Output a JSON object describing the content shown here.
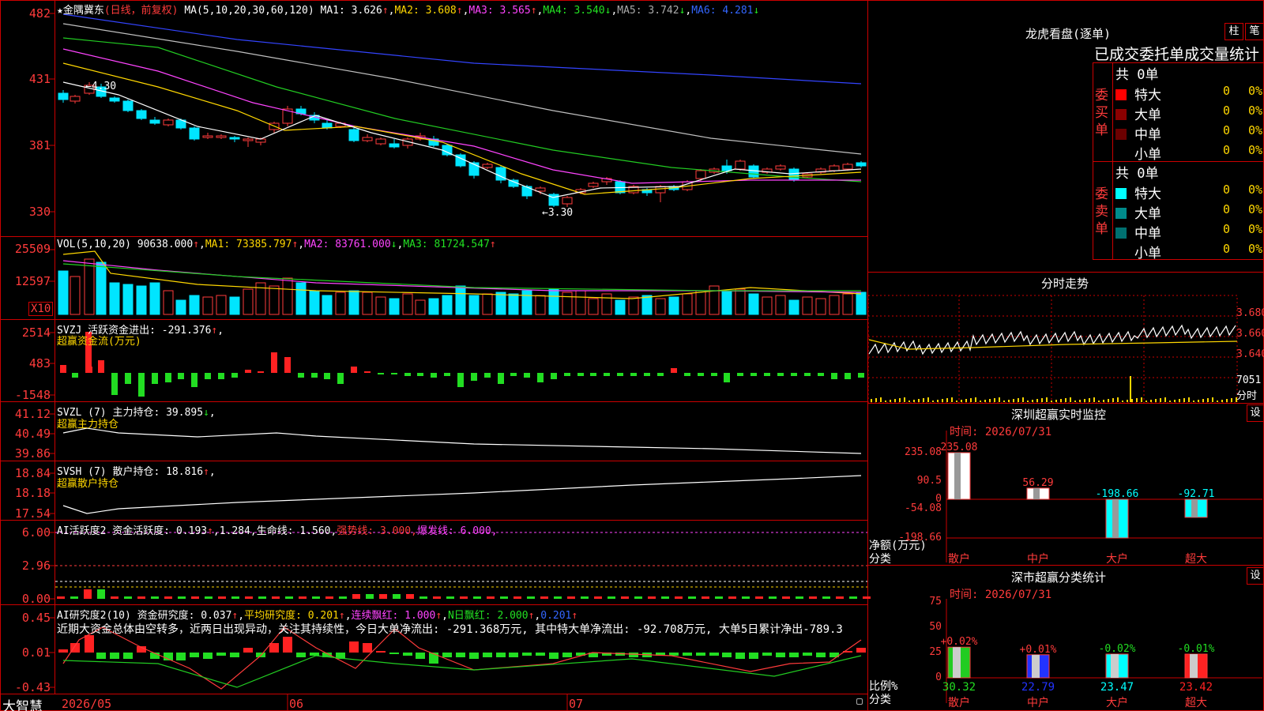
{
  "stock": {
    "title": "金隅冀东",
    "mode": "(日线，前复权)"
  },
  "main": {
    "ma_head": "MA(5,10,20,30,60,120)",
    "ma1": "MA1: 3.626",
    "ma2": "MA2: 3.608",
    "ma3": "MA3: 3.565",
    "ma4": "MA4: 3.540",
    "ma5": "MA5: 3.742",
    "ma6": "MA6: 4.281",
    "up": "↑",
    "down": "↓",
    "hi_label": "←4.30",
    "lo_label": "←3.30",
    "y_ticks": [
      "482",
      "431",
      "381",
      "330"
    ]
  },
  "vol": {
    "head": "VOL(5,10,20)",
    "value": "90638.000",
    "ma1": "MA1: 73385.797",
    "ma2": "MA2: 83761.000",
    "ma3": "MA3: 81724.547",
    "y_ticks": [
      "25509",
      "12597"
    ],
    "unit": "X10"
  },
  "svzj": {
    "head": "SVZJ  活跃资金进出: -291.376",
    "sub": "超赢资金流(万元)",
    "y_ticks": [
      "2514",
      "483",
      "-1548"
    ]
  },
  "svzl": {
    "head": "SVZL (7) 主力持仓: 39.895",
    "sub": "超赢主力持仓",
    "y_ticks": [
      "41.12",
      "40.49",
      "39.86"
    ]
  },
  "svsh": {
    "head": "SVSH (7) 散户持仓: 18.816",
    "sub": "超赢散户持仓",
    "y_ticks": [
      "18.84",
      "18.18",
      "17.54"
    ]
  },
  "ai1": {
    "head": "AI活跃度2 资金活跃度: 0.193",
    "v2": "1.284,",
    "life": "生命线: 1.560,",
    "strong": "强势线: 3.000,",
    "burst": "爆发线: 6.000,",
    "y_ticks": [
      "6.00",
      "2.96",
      "0.00"
    ]
  },
  "ai2": {
    "head": "AI研究度2(10) 资金研究度: 0.037",
    "avg": "平均研究度: 0.201",
    "cont": "连续飘红: 1.000",
    "nday": "N日飘红: 2.000",
    "last": "0.201",
    "text": "近期大资金总体由空转多，近两日出现异动，关注其持续性，今日大单净流出: -291.368万元, 其中特大单净流出: -92.708万元, 大单5日累计净出-789.3",
    "y_ticks": [
      "0.45",
      "0.01",
      "-0.43"
    ]
  },
  "xaxis": {
    "logo": "大智慧",
    "labels": [
      "2026/05",
      "06",
      "07"
    ]
  },
  "lhb": {
    "title": "龙虎看盘(逐单)",
    "btn1": "柱",
    "btn2": "笔",
    "subtitle": "已成交委托单成交量统计",
    "buy_label": "委买单",
    "sell_label": "委卖单",
    "total": "共 0单",
    "buy": [
      {
        "name": "特大",
        "v": "0",
        "p": "0%",
        "color": "#ff0000"
      },
      {
        "name": "大单",
        "v": "0",
        "p": "0%",
        "color": "#8b0000"
      },
      {
        "name": "中单",
        "v": "0",
        "p": "0%",
        "color": "#6b0000"
      },
      {
        "name": "小单",
        "v": "0",
        "p": "0%",
        "color": "#000000"
      }
    ],
    "sell": [
      {
        "name": "特大",
        "v": "0",
        "p": "0%",
        "color": "#00ffff"
      },
      {
        "name": "大单",
        "v": "0",
        "p": "0%",
        "color": "#008b8b"
      },
      {
        "name": "中单",
        "v": "0",
        "p": "0%",
        "color": "#007070"
      },
      {
        "name": "小单",
        "v": "0",
        "p": "0%",
        "color": "#000000"
      }
    ]
  },
  "fenshi": {
    "title": "分时走势",
    "y_ticks": [
      "3.680",
      "3.660",
      "3.640"
    ],
    "vol_label": "7051",
    "fen": "分时"
  },
  "sz": {
    "title": "深圳超赢实时监控",
    "btn": "设",
    "time": "时间: 2026/07/31",
    "y_ticks": [
      "235.08",
      "90.5",
      "0",
      "-54.08",
      "-198.66"
    ],
    "ylabel": "净额(万元)",
    "xlabel": "分类",
    "bars": [
      {
        "cat": "散户",
        "value": 235.08,
        "label": "235.08"
      },
      {
        "cat": "中户",
        "value": 56.29,
        "label": "56.29"
      },
      {
        "cat": "大户",
        "value": -198.66,
        "label": "-198.66"
      },
      {
        "cat": "超大",
        "value": -92.71,
        "label": "-92.71"
      }
    ]
  },
  "sc": {
    "title": "深市超赢分类统计",
    "btn": "设",
    "time": "时间: 2026/07/31",
    "y_ticks": [
      "75",
      "50",
      "25",
      "0"
    ],
    "ylabel": "比例%",
    "xlabel": "分类",
    "bars": [
      {
        "cat": "散户",
        "value": 30.32,
        "label": "+0.02%",
        "color": "#22cc22"
      },
      {
        "cat": "中户",
        "value": 22.79,
        "label": "+0.01%",
        "color": "#2233ff"
      },
      {
        "cat": "大户",
        "value": 23.47,
        "label": "-0.02%",
        "color": "#00ffff"
      },
      {
        "cat": "超大",
        "value": 23.42,
        "label": "-0.01%",
        "color": "#ff2222"
      }
    ]
  }
}
